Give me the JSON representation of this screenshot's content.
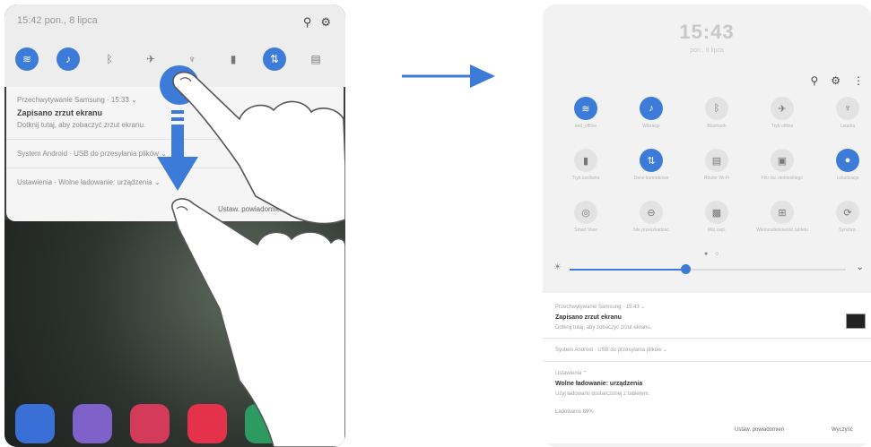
{
  "left": {
    "status_time": "15:42 pon., 8 lipca",
    "toggles": [
      {
        "icon": "wifi-icon",
        "glyph": "≋",
        "on": true
      },
      {
        "icon": "mute-icon",
        "glyph": "♪",
        "on": true
      },
      {
        "icon": "bluetooth-icon",
        "glyph": "ᛒ",
        "on": false
      },
      {
        "icon": "airplane-icon",
        "glyph": "✈",
        "on": false
      },
      {
        "icon": "flashlight-icon",
        "glyph": "♆",
        "on": false
      },
      {
        "icon": "battery-icon",
        "glyph": "▮",
        "on": false
      },
      {
        "icon": "data-icon",
        "glyph": "⇅",
        "on": true
      },
      {
        "icon": "nfc-icon",
        "glyph": "▤",
        "on": false
      }
    ],
    "notifications": [
      {
        "app": "Przechwytywanie Samsung · 15:33 ⌄",
        "title": "Zapisano zrzut ekranu",
        "text": "Dotknij tutaj, aby zobaczyć zrzut ekranu."
      },
      {
        "app": "System Android · USB do przesyłania plików ⌄"
      },
      {
        "app": "Ustawienia · Wolne ładowanie: urządzenia ⌄"
      }
    ],
    "clear_label": "Ustaw. powiadomień"
  },
  "right": {
    "time": "15:43",
    "date": "pon., 8 lipca",
    "tiles": [
      {
        "icon": "wifi-icon",
        "glyph": "≋",
        "on": true,
        "label": "eed_offline"
      },
      {
        "icon": "mute-icon",
        "glyph": "♪",
        "on": true,
        "label": "Wibracje"
      },
      {
        "icon": "bluetooth-icon",
        "glyph": "ᛒ",
        "on": false,
        "label": "Bluetooth"
      },
      {
        "icon": "airplane-icon",
        "glyph": "✈",
        "on": false,
        "label": "Tryb offline"
      },
      {
        "icon": "flashlight-icon",
        "glyph": "♆",
        "on": false,
        "label": "Latarka"
      },
      {
        "icon": "battery-icon",
        "glyph": "▮",
        "on": false,
        "label": "Tryb zasilania"
      },
      {
        "icon": "data-icon",
        "glyph": "⇅",
        "on": true,
        "label": "Dane komórkowe"
      },
      {
        "icon": "hotspot-icon",
        "glyph": "▤",
        "on": false,
        "label": "Router Wi-Fi"
      },
      {
        "icon": "reading-icon",
        "glyph": "▣",
        "on": false,
        "label": "Filtr św. niebieskiego"
      },
      {
        "icon": "location-icon",
        "glyph": "●",
        "on": true,
        "label": "Lokalizacja"
      },
      {
        "icon": "smart-view-icon",
        "glyph": "◎",
        "on": false,
        "label": "Smart View"
      },
      {
        "icon": "dnd-icon",
        "glyph": "⊖",
        "on": false,
        "label": "Nie przeszkadzać"
      },
      {
        "icon": "folder-icon",
        "glyph": "▩",
        "on": false,
        "label": "Mój zapl."
      },
      {
        "icon": "multiwindow-icon",
        "glyph": "⊞",
        "on": false,
        "label": "Wielozadaniowość tabletu"
      },
      {
        "icon": "sync-icon",
        "glyph": "⟳",
        "on": false,
        "label": "Synchro."
      }
    ],
    "page_dots": "● ○",
    "brightness": 0.42,
    "notifications": [
      {
        "app": "Przechwytywanie Samsung · 15:43 ⌄",
        "title": "Zapisano zrzut ekranu",
        "text": "Dotknij tutaj, aby zobaczyć zrzut ekranu."
      },
      {
        "app": "System Android · USB do przesyłania plików ⌄"
      },
      {
        "app": "Ustawienia ⌃",
        "title": "Wolne ładowanie: urządzenia",
        "text": "Użyj ładowarki dostarczonej z tabletem.",
        "extra": "Ładowanie 89%"
      }
    ],
    "footer_left": "Ustaw. powiadomień",
    "footer_right": "Wyczyść"
  },
  "colors": {
    "accent": "#3d7bd9"
  }
}
